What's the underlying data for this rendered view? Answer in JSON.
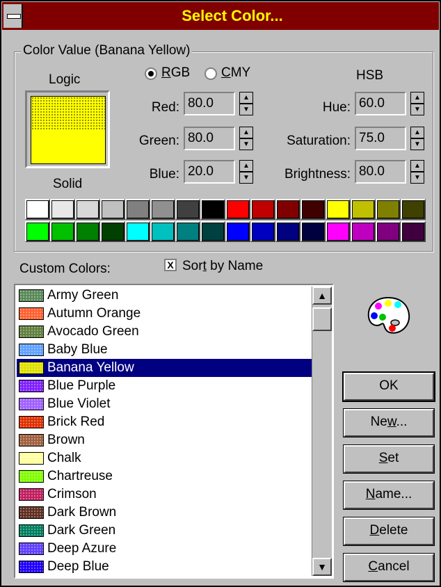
{
  "window": {
    "title": "Select Color..."
  },
  "group": {
    "label": "Color Value (Banana Yellow)",
    "logic_label": "Logic",
    "solid_label": "Solid"
  },
  "mode": {
    "rgb_label_u": "R",
    "rgb_label_rest": "GB",
    "cmy_label_u": "C",
    "cmy_label_rest": "MY",
    "selected": "RGB"
  },
  "rgb": {
    "red_label": "Red:",
    "red_value": "80.0",
    "green_label": "Green:",
    "green_value": "80.0",
    "blue_label": "Blue:",
    "blue_value": "20.0"
  },
  "hsb": {
    "heading": "HSB",
    "hue_label": "Hue:",
    "hue_value": "60.0",
    "sat_label": "Saturation:",
    "sat_value": "75.0",
    "bri_label": "Brightness:",
    "bri_value": "80.0"
  },
  "swatches": {
    "row1": [
      "#ffffff",
      "#e8e8e8",
      "#d8d8d8",
      "#c0c0c0",
      "#808080",
      "#909090",
      "#404040",
      "#000000",
      "#ff0000",
      "#c00000",
      "#800000",
      "#400000",
      "#ffff00",
      "#c0c000",
      "#808000",
      "#404000"
    ],
    "row2": [
      "#00ff00",
      "#00c000",
      "#008000",
      "#004000",
      "#00ffff",
      "#00c0c0",
      "#008080",
      "#004040",
      "#0000ff",
      "#0000c0",
      "#000080",
      "#000040",
      "#ff00ff",
      "#c000c0",
      "#800080",
      "#400040"
    ]
  },
  "custom": {
    "label": "Custom Colors:",
    "sort_u": "t",
    "sort_pre": "Sor",
    "sort_post": " by Name",
    "sort_checked": "X",
    "items": [
      {
        "name": "Army Green",
        "color": "#5a8a5a"
      },
      {
        "name": "Autumn Orange",
        "color": "#ff6030"
      },
      {
        "name": "Avocado Green",
        "color": "#608040"
      },
      {
        "name": "Baby Blue",
        "color": "#60a0ff"
      },
      {
        "name": "Banana Yellow",
        "color": "#e0e000"
      },
      {
        "name": "Blue Purple",
        "color": "#8020ff"
      },
      {
        "name": "Blue Violet",
        "color": "#a060ff"
      },
      {
        "name": "Brick Red",
        "color": "#e03000"
      },
      {
        "name": "Brown",
        "color": "#a06040"
      },
      {
        "name": "Chalk",
        "color": "#ffffa0"
      },
      {
        "name": "Chartreuse",
        "color": "#80ff00"
      },
      {
        "name": "Crimson",
        "color": "#c02060"
      },
      {
        "name": "Dark Brown",
        "color": "#603020"
      },
      {
        "name": "Dark Green",
        "color": "#008060"
      },
      {
        "name": "Deep Azure",
        "color": "#6040ff"
      },
      {
        "name": "Deep Blue",
        "color": "#2000ff"
      }
    ],
    "selected_index": 4
  },
  "buttons": {
    "ok": "OK",
    "new_pre": "Ne",
    "new_u": "w",
    "new_post": "...",
    "set_u": "S",
    "set_post": "et",
    "name_u": "N",
    "name_post": "ame...",
    "delete_u": "D",
    "delete_post": "elete",
    "cancel_u": "C",
    "cancel_post": "ancel"
  },
  "scroll": {
    "up_icon": "▲",
    "down_icon": "▼"
  },
  "icons": {
    "palette": "palette-icon",
    "sysmenu": "system-menu-icon"
  }
}
